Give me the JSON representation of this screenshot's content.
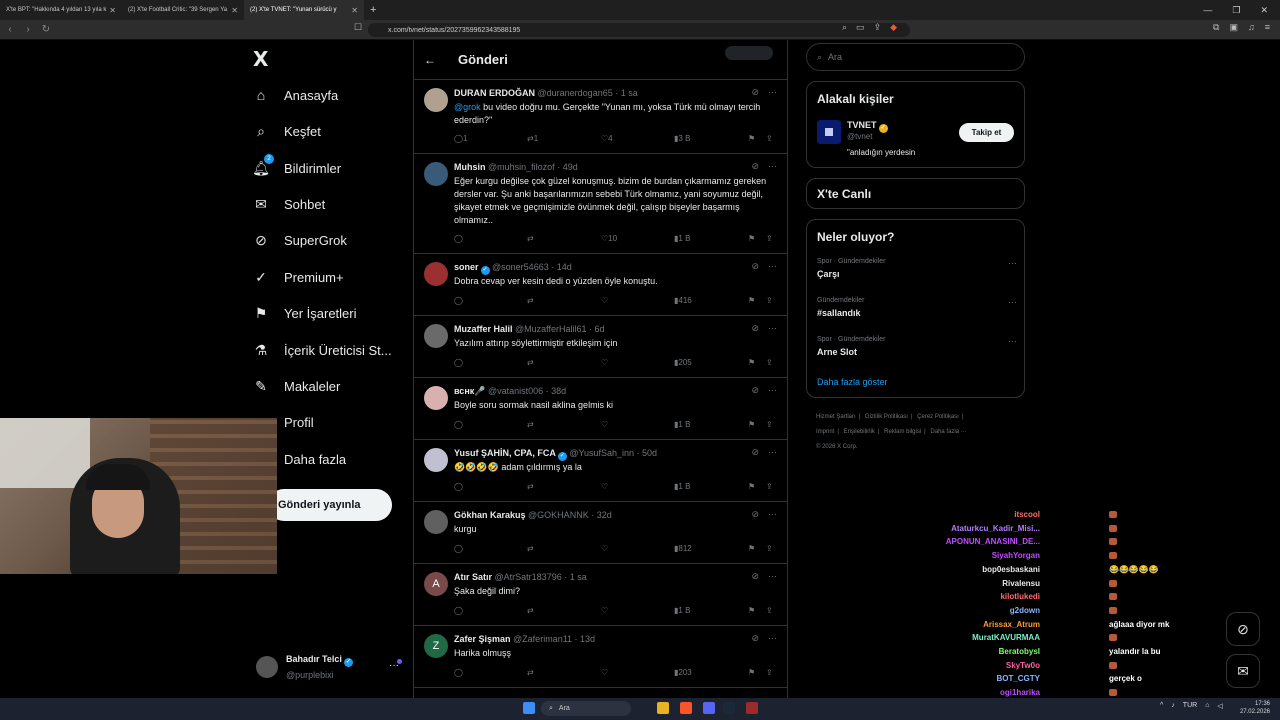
{
  "browser": {
    "tabs": [
      {
        "label": "X'te BPT: \"Hakkında 4 yıldan 13 yıla k"
      },
      {
        "label": "(2) X'te Football Critic: \"39 Sergen Ya"
      },
      {
        "label": "(2) X'te TVNET: \"Yunan sürücü y"
      }
    ],
    "url": "x.com/tvnet/status/2027359962343588195"
  },
  "nav": {
    "logo": "X",
    "items": [
      {
        "label": "Anasayfa",
        "icon": "home-icon"
      },
      {
        "label": "Keşfet",
        "icon": "search-icon"
      },
      {
        "label": "Bildirimler",
        "icon": "bell-icon",
        "badge": "2"
      },
      {
        "label": "Sohbet",
        "icon": "mail-icon"
      },
      {
        "label": "SuperGrok",
        "icon": "grok-icon"
      },
      {
        "label": "Premium+",
        "icon": "premium-icon"
      },
      {
        "label": "Yer İşaretleri",
        "icon": "bookmark-icon"
      },
      {
        "label": "İçerik Üreticisi St...",
        "icon": "flask-icon"
      },
      {
        "label": "Makaleler",
        "icon": "article-icon"
      },
      {
        "label": "Profil",
        "icon": "profile-icon"
      },
      {
        "label": "Daha fazla",
        "icon": "more-icon"
      }
    ],
    "post_button": "Gönderi yayınla",
    "profile": {
      "name": "Bahadır Telci",
      "handle": "@purplebixi"
    }
  },
  "center": {
    "title": "Gönderi",
    "tweets": [
      {
        "name": "DURAN ERDOĞAN",
        "handle": "@duranerdogan65",
        "time": "1 sa",
        "verified": false,
        "mention": "@grok",
        "text": " bu video doğru mu. Gerçekte \"Yunan mı, yoksa Türk mü olmayı tercih ederdin?\"",
        "replies": "1",
        "reposts": "1",
        "likes": "4",
        "views": "3 B"
      },
      {
        "name": "Muhsin",
        "handle": "@muhsin_filozof",
        "time": "49d",
        "verified": false,
        "mention": "",
        "text": "Eğer kurgu değilse çok güzel konuşmuş. bizim de burdan çıkarmamız gereken dersler var. Şu anki başarılarımızın sebebi Türk olmamız, yani soyumuz değil, şikayet etmek ve geçmişimizle övünmek değil, çalışıp bişeyler başarmış olmamız..",
        "replies": "",
        "reposts": "",
        "likes": "10",
        "views": "1 B"
      },
      {
        "name": "soner",
        "handle": "@soner54663",
        "time": "14d",
        "verified": true,
        "mention": "",
        "text": "Dobra cevap ver kesin dedi o yüzden öyle konuştu.",
        "replies": "",
        "reposts": "",
        "likes": "",
        "views": "416"
      },
      {
        "name": "Muzaffer Halil",
        "handle": "@MuzafferHalil61",
        "time": "6d",
        "verified": false,
        "mention": "",
        "text": "Yazılım attırıp söylettirmiştir etkileşim için",
        "replies": "",
        "reposts": "",
        "likes": "",
        "views": "205"
      },
      {
        "name": "вснк🎤",
        "handle": "@vatanist006",
        "time": "38d",
        "verified": false,
        "mention": "",
        "text": "Boyle soru sormak nasil aklina gelmis ki",
        "replies": "",
        "reposts": "",
        "likes": "",
        "views": "1 B"
      },
      {
        "name": "Yusuf ŞAHİN, CPA, FCA",
        "handle": "@YusufSah_inn",
        "time": "50d",
        "verified": true,
        "mention": "",
        "text": "🤣🤣🤣🤣 adam çıldırmış ya la",
        "replies": "",
        "reposts": "",
        "likes": "",
        "views": "1 B"
      },
      {
        "name": "Gökhan Karakuş",
        "handle": "@GOKHANNK",
        "time": "32d",
        "verified": false,
        "mention": "",
        "text": "kurgu",
        "replies": "",
        "reposts": "",
        "likes": "",
        "views": "812"
      },
      {
        "name": "Atır Satır",
        "handle": "@AtrSatr183796",
        "time": "1 sa",
        "verified": false,
        "mention": "",
        "text": "Şaka değil dimi?",
        "replies": "",
        "reposts": "",
        "likes": "",
        "views": "1 B"
      },
      {
        "name": "Zafer Şişman",
        "handle": "@Zaferiman11",
        "time": "13d",
        "verified": false,
        "mention": "",
        "text": "Harika olmuşş",
        "replies": "",
        "reposts": "",
        "likes": "",
        "views": "203"
      }
    ]
  },
  "right": {
    "search_placeholder": "Ara",
    "related_title": "Alakalı kişiler",
    "related": {
      "name": "TVNET",
      "handle": "@tvnet",
      "bio": "\"anladığın yerdesin",
      "follow": "Takip et"
    },
    "live_title": "X'te Canlı",
    "trends_title": "Neler oluyor?",
    "trends": [
      {
        "category": "Spor · Gündemdekiler",
        "name": "Çarşı"
      },
      {
        "category": "Gündemdekiler",
        "name": "#sallandık"
      },
      {
        "category": "Spor · Gündemdekiler",
        "name": "Arne Slot"
      }
    ],
    "show_more": "Daha fazla göster",
    "footer": [
      "Hizmet Şartları",
      "|",
      "Gizlilik Politikası",
      "|",
      "Çerez Politikası",
      "|",
      "Imprint",
      "|",
      "Erişilebilirlik",
      "|",
      "Reklam bilgisi",
      "|",
      "Daha fazla ···",
      "© 2026 X Corp."
    ]
  },
  "chat": {
    "lines": [
      {
        "user": "itscool",
        "msg": "",
        "color": "#ff6b6b"
      },
      {
        "user": "Ataturkcu_Kadir_Misi...",
        "msg": "",
        "color": "#b07cff"
      },
      {
        "user": "APONUN_ANASINI_DE...",
        "msg": "",
        "color": "#c04cff"
      },
      {
        "user": "SiyahYorgan",
        "msg": "",
        "color": "#c04cff"
      },
      {
        "user": "bop0esbaskani",
        "msg": "😂😂😂😂😂",
        "color": "#e7e9ea"
      },
      {
        "user": "Rivalensu",
        "msg": "",
        "color": "#e7e9ea"
      },
      {
        "user": "kilotlukedi",
        "msg": "",
        "color": "#ff6b6b"
      },
      {
        "user": "g2down",
        "msg": "",
        "color": "#8ab4ff"
      },
      {
        "user": "Arissax_Atrum",
        "msg": "ağlaaa diyor mk",
        "color": "#ff9d2e"
      },
      {
        "user": "MuratKAVURMAA",
        "msg": "",
        "color": "#7cf0c8"
      },
      {
        "user": "Beratobysl",
        "msg": "yalandır la bu",
        "color": "#7cff6b"
      },
      {
        "user": "SkyTw0o",
        "msg": "",
        "color": "#ff5fa2"
      },
      {
        "user": "BOT_CGTY",
        "msg": "gerçek o",
        "color": "#8ab4ff"
      },
      {
        "user": "ogi1harika",
        "msg": "",
        "color": "#c04cff"
      },
      {
        "user": "Sarney",
        "msg": "",
        "color": "#8ab4ff"
      }
    ]
  },
  "taskbar": {
    "search": "Ara",
    "lang": "TUR",
    "time": "17:36",
    "date": "27.02.2026"
  }
}
